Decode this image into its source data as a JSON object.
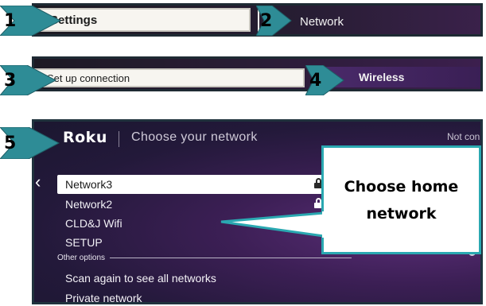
{
  "steps": [
    {
      "number": "1",
      "label": "Settings"
    },
    {
      "number": "2",
      "label": "Network"
    },
    {
      "number": "3",
      "label": "Set up connection"
    },
    {
      "number": "4",
      "label": "Wireless"
    },
    {
      "number": "5"
    }
  ],
  "screen": {
    "logo": "Roku",
    "title": "Choose your network",
    "status": "Not conn",
    "back_icon": "chevron-left-icon",
    "networks": [
      {
        "name": "Network3",
        "secured": true,
        "signal": true,
        "selected": true
      },
      {
        "name": "Network2",
        "secured": true,
        "signal": true,
        "selected": false
      },
      {
        "name": "CLD&J Wifi",
        "secured": false,
        "signal": false,
        "selected": false
      },
      {
        "name": "SETUP",
        "secured": false,
        "signal": true,
        "selected": false
      }
    ],
    "other_options_label": "Other options",
    "options": [
      "Scan again to see all networks",
      "Private network"
    ]
  },
  "callout": {
    "text": "Choose home network"
  },
  "colors": {
    "accent_teal": "#2aa8b1",
    "roku_purple": "#3c1f55",
    "arrow_fill": "#2e8c96"
  }
}
